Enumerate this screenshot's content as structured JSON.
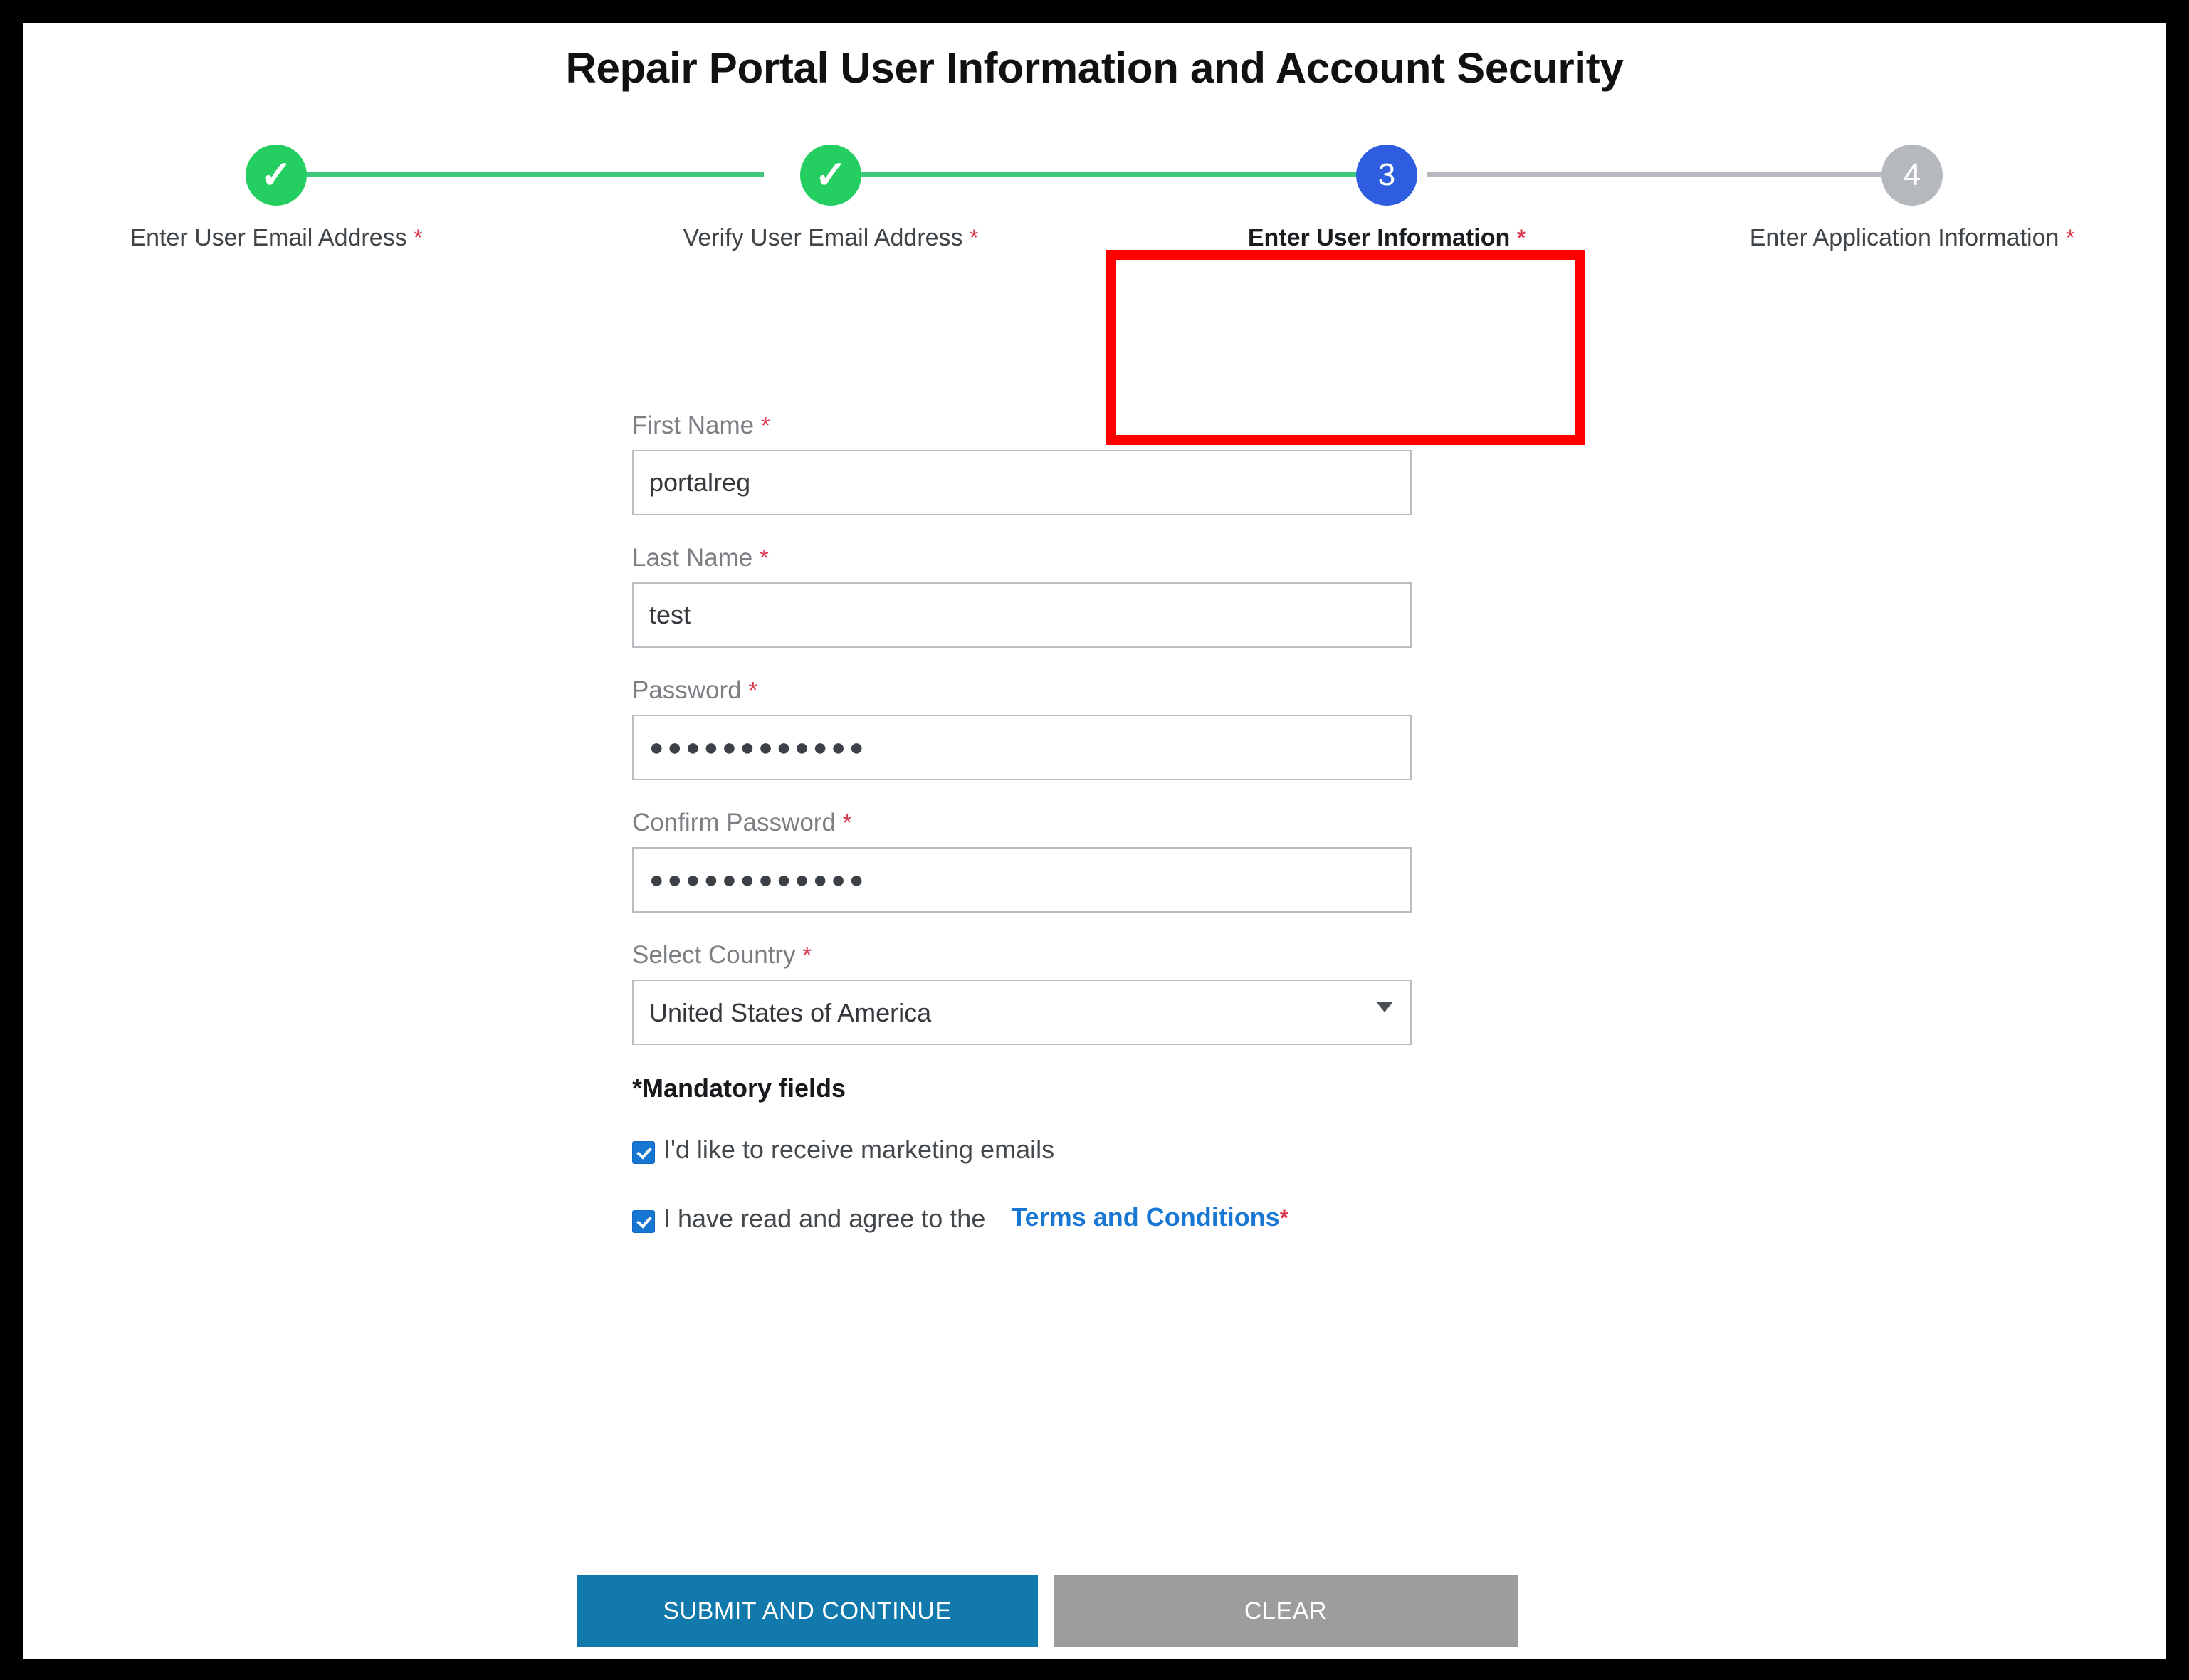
{
  "page": {
    "title": "Repair Portal User Information and Account Security",
    "required_marker": "*",
    "colors": {
      "step_done": "#24ce60",
      "step_active": "#2f5de0",
      "step_todo": "#b5b9bd",
      "highlight_box": "#ff0000",
      "link": "#1877d2",
      "checkbox": "#1776d2",
      "primary_button": "#1179ab",
      "secondary_button": "#9d9d9d",
      "required_asterisk": "#d93a4f"
    }
  },
  "stepper": {
    "steps": [
      {
        "number": "1",
        "glyph": "✓",
        "label": "Enter User Email Address",
        "state": "done",
        "required": "*",
        "icon": "check-icon"
      },
      {
        "number": "2",
        "glyph": "✓",
        "label": "Verify User Email Address",
        "state": "done",
        "required": "*",
        "icon": "check-icon"
      },
      {
        "number": "3",
        "glyph": "3",
        "label": "Enter User Information",
        "state": "active",
        "required": "*",
        "icon": "step-number-3"
      },
      {
        "number": "4",
        "glyph": "4",
        "label": "Enter Application Information",
        "state": "todo",
        "required": "*",
        "icon": "step-number-4"
      }
    ]
  },
  "form": {
    "first_name": {
      "label": "First Name",
      "required": "*",
      "value": "portalreg",
      "placeholder": ""
    },
    "last_name": {
      "label": "Last Name",
      "required": "*",
      "value": "test",
      "placeholder": ""
    },
    "password": {
      "label": "Password",
      "required": "*",
      "value": "●●●●●●●●●●●●",
      "placeholder": ""
    },
    "confirm_password": {
      "label": "Confirm Password",
      "required": "*",
      "value": "●●●●●●●●●●●●",
      "placeholder": ""
    },
    "country": {
      "label": "Select Country",
      "required": "*",
      "selected": "United States of America",
      "icon": "chevron-down-icon"
    },
    "mandatory_note": "*Mandatory fields",
    "marketing_checkbox": {
      "label": "I'd like to receive marketing emails",
      "checked": true
    },
    "terms_checkbox": {
      "label": "I have read and agree to the",
      "link_text": "Terms and Conditions",
      "required": "*",
      "checked": true
    }
  },
  "buttons": {
    "submit": "SUBMIT AND CONTINUE",
    "clear": "CLEAR"
  }
}
